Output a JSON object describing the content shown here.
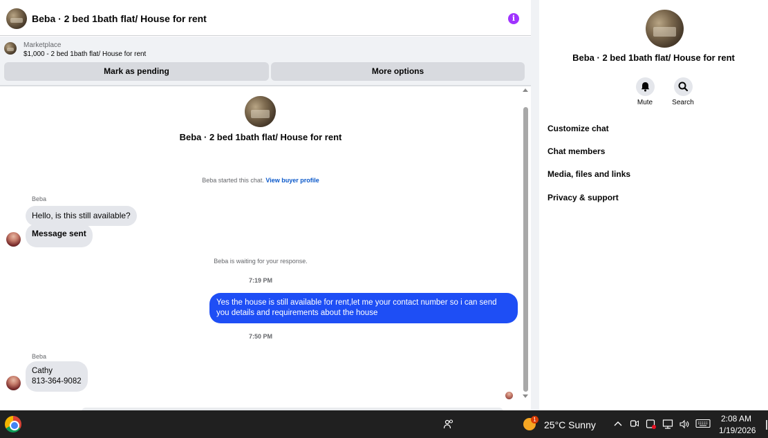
{
  "chat": {
    "title": "Beba · 2 bed 1bath flat/ House for rent",
    "marketplace_label": "Marketplace",
    "listing": "$1,000 - 2 bed 1bath flat/ House for rent",
    "mark_pending": "Mark as pending",
    "more_options": "More options",
    "intro_title": "Beba · 2 bed 1bath flat/ House for rent",
    "started_text": "Beba started this chat.",
    "view_profile": "View buyer profile",
    "waiting_text": "Beba is waiting for your response.",
    "messages": [
      {
        "sender": "Beba",
        "text": "Hello, is this still available?"
      },
      {
        "text": "Message sent"
      },
      {
        "time": "7:19 PM"
      },
      {
        "text": "Yes the house is still available for rent,let me your contact number so i can send you details and requirements about the house"
      },
      {
        "time": "7:50 PM"
      },
      {
        "sender": "Beba",
        "line1": "Cathy",
        "line2": "813-364-9082"
      }
    ]
  },
  "panel": {
    "title": "Beba · 2 bed 1bath flat/ House for rent",
    "mute": "Mute",
    "search": "Search",
    "menu": [
      "Customize chat",
      "Chat members",
      "Media, files and links",
      "Privacy & support"
    ]
  },
  "taskbar": {
    "weather_badge": "1",
    "weather": "25°C  Sunny",
    "time": "2:08 AM",
    "date": "1/19/2026"
  },
  "colors": {
    "accent_blue": "#1e4ef5",
    "info_purple": "#a033ff",
    "link_blue": "#0a58ca"
  }
}
